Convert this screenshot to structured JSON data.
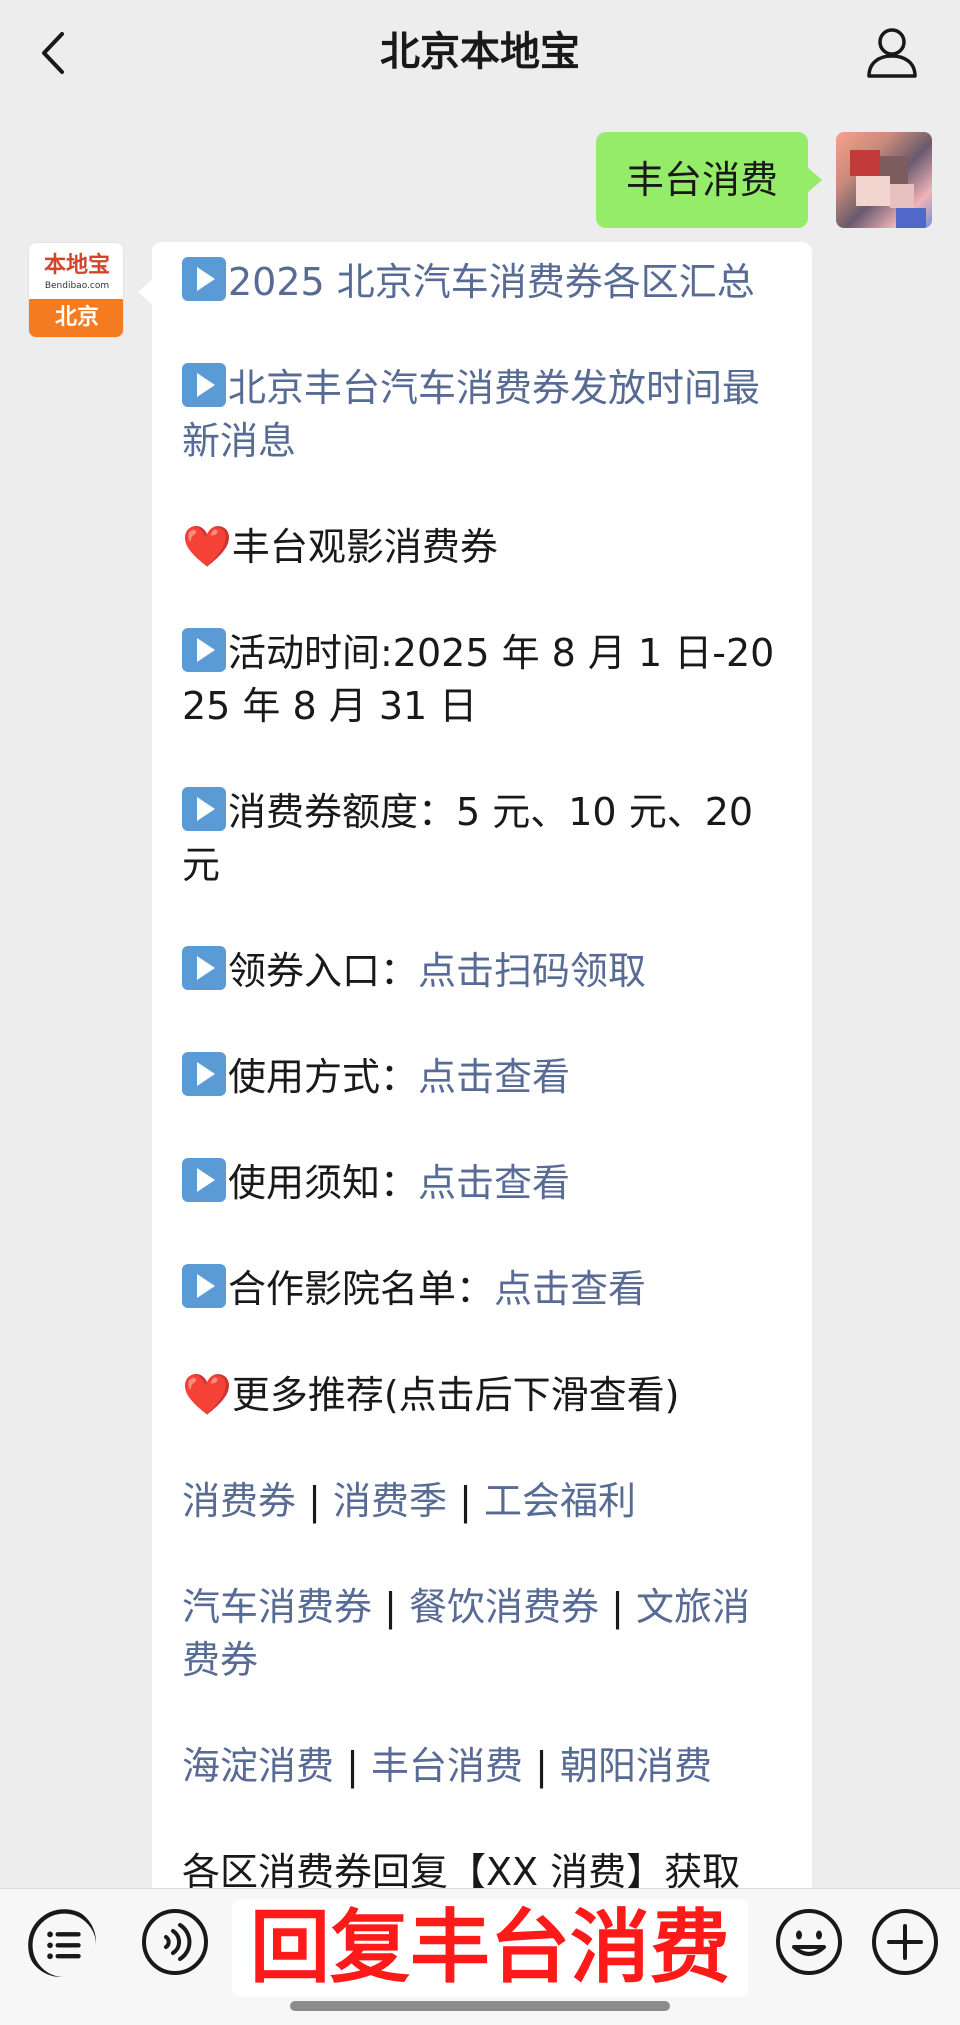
{
  "header": {
    "title": "北京本地宝"
  },
  "chat": {
    "sent_message": "丰台消费",
    "reply": {
      "logo": {
        "top": "本地宝",
        "sub": "Bendibao.com",
        "bottom": "北京"
      },
      "lines": [
        {
          "type": "link",
          "emoji": "play",
          "text": "2025 北京汽车消费券各区汇总"
        },
        {
          "type": "link",
          "emoji": "play",
          "text": "北京丰台汽车消费券发放时间最新消息"
        },
        {
          "type": "text",
          "emoji": "heart",
          "text": "丰台观影消费券"
        },
        {
          "type": "text",
          "emoji": "play",
          "text": "活动时间:2025 年 8 月 1 日-2025 年 8 月 31 日"
        },
        {
          "type": "text",
          "emoji": "play",
          "text": "消费券额度：5 元、10 元、20 元"
        },
        {
          "type": "mixed",
          "emoji": "play",
          "label": "领券入口：",
          "link": "点击扫码领取"
        },
        {
          "type": "mixed",
          "emoji": "play",
          "label": "使用方式：",
          "link": "点击查看"
        },
        {
          "type": "mixed",
          "emoji": "play",
          "label": "使用须知：",
          "link": "点击查看"
        },
        {
          "type": "mixed",
          "emoji": "play",
          "label": "合作影院名单：",
          "link": "点击查看"
        },
        {
          "type": "text",
          "emoji": "heart",
          "text": "更多推荐(点击后下滑查看)"
        }
      ],
      "link_groups": [
        [
          "消费券",
          "消费季",
          "工会福利"
        ],
        [
          "汽车消费券",
          "餐饮消费券",
          "文旅消费券"
        ],
        [
          "海淀消费",
          "丰台消费",
          "朝阳消费"
        ]
      ],
      "trailing_text": "各区消费券回复【XX 消费】获取"
    }
  },
  "input": {
    "overlay_text": "回复丰台消费"
  },
  "colors": {
    "link": "#576b95",
    "sent_bubble": "#95ec69",
    "overlay_text": "#ff1a1a"
  }
}
